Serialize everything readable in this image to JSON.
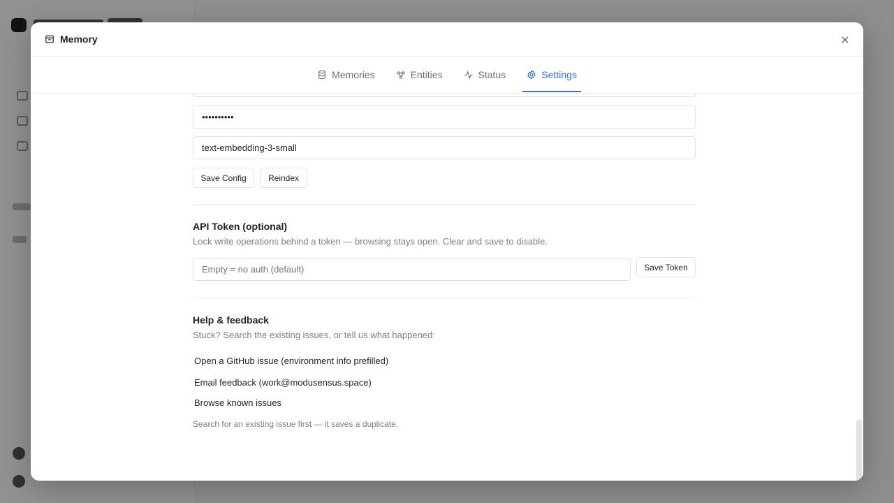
{
  "modal": {
    "title": "Memory",
    "title_icon": "archive-box-icon",
    "close_icon": "close-icon"
  },
  "tabs": [
    {
      "label": "Memories",
      "icon": "database-icon"
    },
    {
      "label": "Entities",
      "icon": "entities-icon"
    },
    {
      "label": "Status",
      "icon": "activity-icon"
    },
    {
      "label": "Settings",
      "icon": "gear-icon",
      "active": true
    }
  ],
  "embedding": {
    "api_key_value": "••••••••••",
    "model_value": "text-embedding-3-small",
    "save_config_label": "Save Config",
    "reindex_label": "Reindex"
  },
  "api_token": {
    "title": "API Token (optional)",
    "description": "Lock write operations behind a token — browsing stays open. Clear and save to disable.",
    "placeholder": "Empty = no auth (default)",
    "save_label": "Save Token"
  },
  "help": {
    "title": "Help & feedback",
    "description": "Stuck? Search the existing issues, or tell us what happened:",
    "links": [
      "Open a GitHub issue (environment info prefilled)",
      "Email feedback (work@modusensus.space)",
      "Browse known issues"
    ],
    "note": "Search for an existing issue first — it saves a duplicate."
  },
  "colors": {
    "accent": "#2f6fe0",
    "overlay": "rgba(0,0,0,0.42)"
  }
}
